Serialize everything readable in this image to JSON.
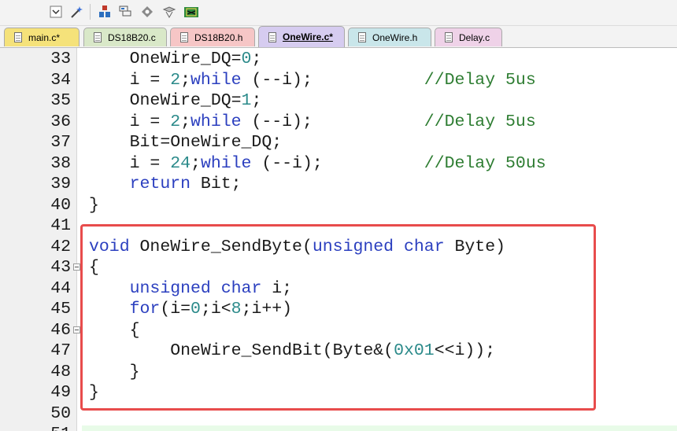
{
  "tabs": [
    {
      "label": "main.c*",
      "color": "#f5e27a",
      "active": false
    },
    {
      "label": "DS18B20.c",
      "color": "#d9e8c8",
      "active": false
    },
    {
      "label": "DS18B20.h",
      "color": "#f6c6c6",
      "active": false
    },
    {
      "label": "OneWire.c*",
      "color": "#d6ccf0",
      "active": true
    },
    {
      "label": "OneWire.h",
      "color": "#c9e6ea",
      "active": false
    },
    {
      "label": "Delay.c",
      "color": "#efd2e8",
      "active": false
    }
  ],
  "toolbar_icons": [
    "dropdown-icon",
    "magic-wand-icon",
    "build-icon",
    "batch-build-icon",
    "options-icon",
    "translate-icon",
    "download-icon"
  ],
  "code_lines": [
    {
      "n": "33",
      "tokens": [
        [
          "",
          "    OneWire_DQ="
        ],
        [
          "num",
          "0"
        ],
        [
          "",
          ";"
        ]
      ]
    },
    {
      "n": "34",
      "tokens": [
        [
          "",
          "    i = "
        ],
        [
          "num",
          "2"
        ],
        [
          "",
          ";"
        ],
        [
          "kw",
          "while"
        ],
        [
          "",
          " (--i);           "
        ],
        [
          "cm",
          "//Delay 5us"
        ]
      ]
    },
    {
      "n": "35",
      "tokens": [
        [
          "",
          "    OneWire_DQ="
        ],
        [
          "num",
          "1"
        ],
        [
          "",
          ";"
        ]
      ]
    },
    {
      "n": "36",
      "tokens": [
        [
          "",
          "    i = "
        ],
        [
          "num",
          "2"
        ],
        [
          "",
          ";"
        ],
        [
          "kw",
          "while"
        ],
        [
          "",
          " (--i);           "
        ],
        [
          "cm",
          "//Delay 5us"
        ]
      ]
    },
    {
      "n": "37",
      "tokens": [
        [
          "",
          "    Bit=OneWire_DQ;"
        ]
      ]
    },
    {
      "n": "38",
      "tokens": [
        [
          "",
          "    i = "
        ],
        [
          "num",
          "24"
        ],
        [
          "",
          ";"
        ],
        [
          "kw",
          "while"
        ],
        [
          "",
          " (--i);          "
        ],
        [
          "cm",
          "//Delay 50us"
        ]
      ]
    },
    {
      "n": "39",
      "tokens": [
        [
          "",
          "    "
        ],
        [
          "kw",
          "return"
        ],
        [
          "",
          " Bit;"
        ]
      ]
    },
    {
      "n": "40",
      "tokens": [
        [
          "",
          "}"
        ]
      ]
    },
    {
      "n": "41",
      "tokens": []
    },
    {
      "n": "42",
      "tokens": [
        [
          "kw",
          "void"
        ],
        [
          "",
          " OneWire_SendByte("
        ],
        [
          "kw",
          "unsigned"
        ],
        [
          "",
          " "
        ],
        [
          "kw",
          "char"
        ],
        [
          "",
          " Byte)"
        ]
      ]
    },
    {
      "n": "43",
      "tokens": [
        [
          "",
          "{"
        ]
      ],
      "fold": true
    },
    {
      "n": "44",
      "tokens": [
        [
          "",
          "    "
        ],
        [
          "kw",
          "unsigned"
        ],
        [
          "",
          " "
        ],
        [
          "kw",
          "char"
        ],
        [
          "",
          " i;"
        ]
      ]
    },
    {
      "n": "45",
      "tokens": [
        [
          "",
          "    "
        ],
        [
          "kw",
          "for"
        ],
        [
          "",
          "(i="
        ],
        [
          "num",
          "0"
        ],
        [
          "",
          ";i<"
        ],
        [
          "num",
          "8"
        ],
        [
          "",
          ";i++)"
        ]
      ]
    },
    {
      "n": "46",
      "tokens": [
        [
          "",
          "    {"
        ]
      ],
      "fold": true
    },
    {
      "n": "47",
      "tokens": [
        [
          "",
          "        OneWire_SendBit(Byte&("
        ],
        [
          "num",
          "0x01"
        ],
        [
          "",
          "<<i));"
        ]
      ]
    },
    {
      "n": "48",
      "tokens": [
        [
          "",
          "    }"
        ]
      ]
    },
    {
      "n": "49",
      "tokens": [
        [
          "",
          "}"
        ]
      ]
    },
    {
      "n": "50",
      "tokens": []
    },
    {
      "n": "51",
      "tokens": []
    }
  ]
}
